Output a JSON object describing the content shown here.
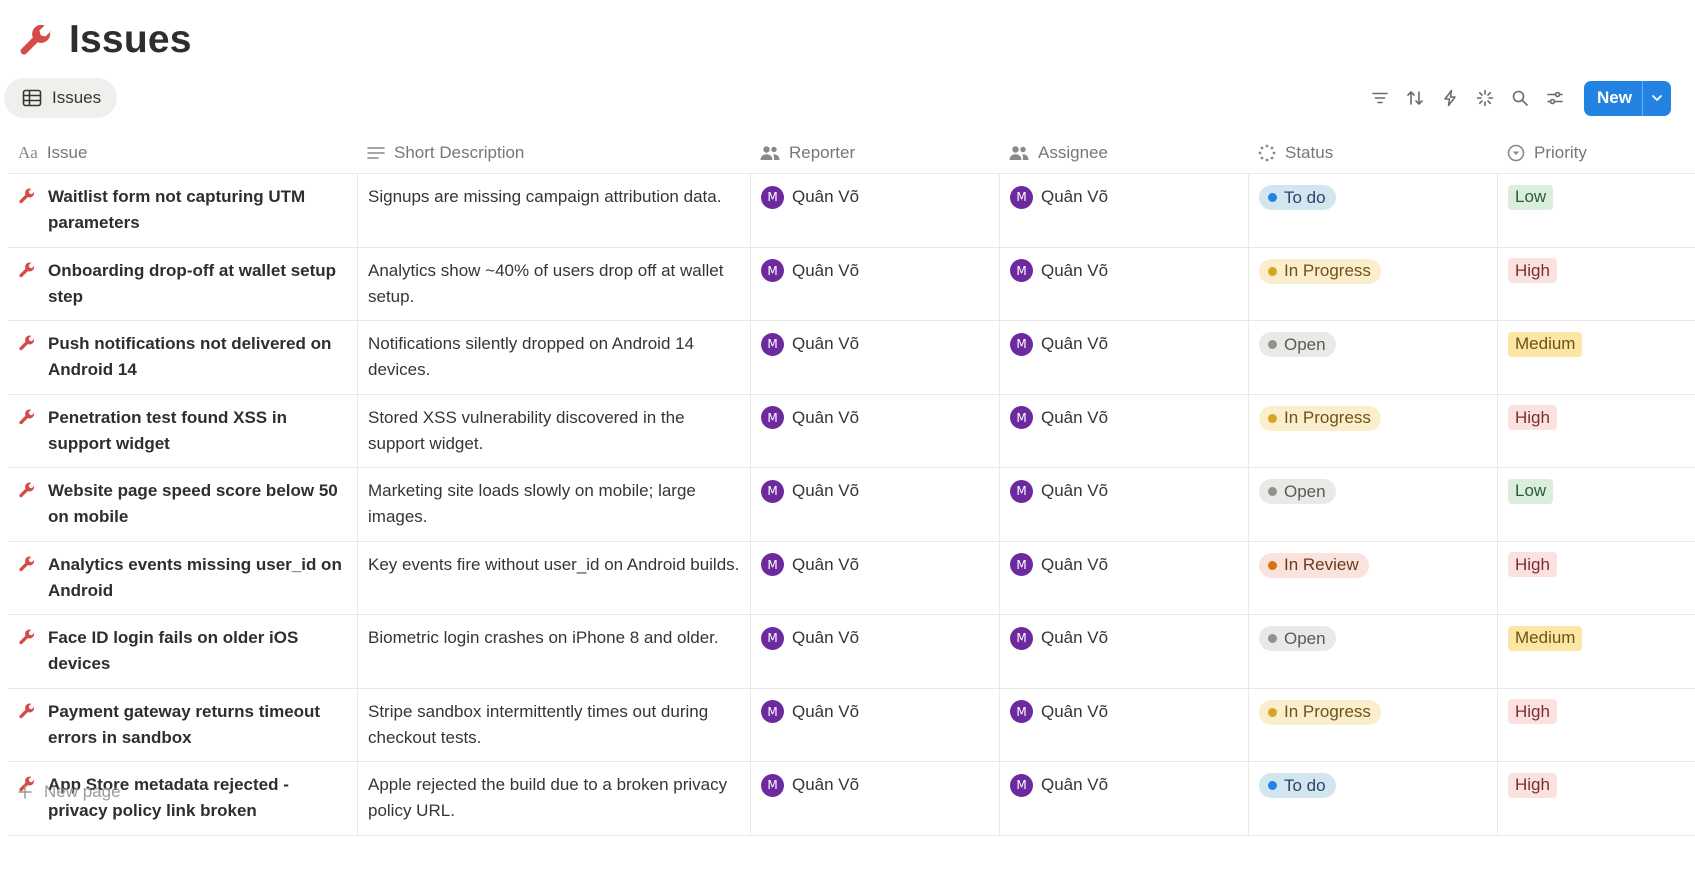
{
  "page": {
    "title": "Issues",
    "icon": "wrench-icon"
  },
  "view": {
    "tab_label": "Issues",
    "new_label": "New"
  },
  "toolbar": [
    "filter-icon",
    "sort-icon",
    "automation-icon",
    "ai-sparkle-icon",
    "search-icon",
    "settings-sliders-icon"
  ],
  "columns": {
    "issue": "Issue",
    "desc": "Short Description",
    "reporter": "Reporter",
    "assignee": "Assignee",
    "status": "Status",
    "priority": "Priority"
  },
  "colors": {
    "accent": "#2383e2",
    "wrench": "#d44c47",
    "avatar": "#6c2a9e",
    "status": {
      "To do": {
        "bg": "#d3e5ef",
        "dot": "#2383e2",
        "text": "#28456c"
      },
      "In Progress": {
        "bg": "#fbeecd",
        "dot": "#d9a521",
        "text": "#6f5316"
      },
      "Open": {
        "bg": "#e9e9e7",
        "dot": "#91918e",
        "text": "#5a5a57"
      },
      "In Review": {
        "bg": "#fae3dc",
        "dot": "#d9730d",
        "text": "#6e3a1c"
      }
    },
    "priority": {
      "Low": {
        "bg": "#dbeddb",
        "text": "#2b593f"
      },
      "High": {
        "bg": "#fbe2e1",
        "text": "#7a2e2e"
      },
      "Medium": {
        "bg": "#fbe6a4",
        "text": "#6f5316"
      }
    }
  },
  "rows": [
    {
      "issue": "Waitlist form not capturing UTM parameters",
      "desc": "Signups are missing campaign attribution data.",
      "reporter": "Quân Võ",
      "reporter_initial": "M",
      "assignee": "Quân Võ",
      "assignee_initial": "M",
      "status": "To do",
      "priority": "Low"
    },
    {
      "issue": "Onboarding drop-off at wallet setup step",
      "desc": "Analytics show ~40% of users drop off at wallet setup.",
      "reporter": "Quân Võ",
      "reporter_initial": "M",
      "assignee": "Quân Võ",
      "assignee_initial": "M",
      "status": "In Progress",
      "priority": "High"
    },
    {
      "issue": "Push notifications not delivered on Android 14",
      "desc": "Notifications silently dropped on Android 14 devices.",
      "reporter": "Quân Võ",
      "reporter_initial": "M",
      "assignee": "Quân Võ",
      "assignee_initial": "M",
      "status": "Open",
      "priority": "Medium"
    },
    {
      "issue": "Penetration test found XSS in support widget",
      "desc": "Stored XSS vulnerability discovered in the support widget.",
      "reporter": "Quân Võ",
      "reporter_initial": "M",
      "assignee": "Quân Võ",
      "assignee_initial": "M",
      "status": "In Progress",
      "priority": "High"
    },
    {
      "issue": "Website page speed score below 50 on mobile",
      "desc": "Marketing site loads slowly on mobile; large images.",
      "reporter": "Quân Võ",
      "reporter_initial": "M",
      "assignee": "Quân Võ",
      "assignee_initial": "M",
      "status": "Open",
      "priority": "Low"
    },
    {
      "issue": "Analytics events missing user_id on Android",
      "desc": "Key events fire without user_id on Android builds.",
      "reporter": "Quân Võ",
      "reporter_initial": "M",
      "assignee": "Quân Võ",
      "assignee_initial": "M",
      "status": "In Review",
      "priority": "High"
    },
    {
      "issue": "Face ID login fails on older iOS devices",
      "desc": "Biometric login crashes on iPhone 8 and older.",
      "reporter": "Quân Võ",
      "reporter_initial": "M",
      "assignee": "Quân Võ",
      "assignee_initial": "M",
      "status": "Open",
      "priority": "Medium"
    },
    {
      "issue": "Payment gateway returns timeout errors in sandbox",
      "desc": "Stripe sandbox intermittently times out during checkout tests.",
      "reporter": "Quân Võ",
      "reporter_initial": "M",
      "assignee": "Quân Võ",
      "assignee_initial": "M",
      "status": "In Progress",
      "priority": "High"
    },
    {
      "issue": "App Store metadata rejected - privacy policy link broken",
      "desc": "Apple rejected the build due to a broken privacy policy URL.",
      "reporter": "Quân Võ",
      "reporter_initial": "M",
      "assignee": "Quân Võ",
      "assignee_initial": "M",
      "status": "To do",
      "priority": "High"
    }
  ],
  "footer": {
    "new_page_label": "New page"
  }
}
